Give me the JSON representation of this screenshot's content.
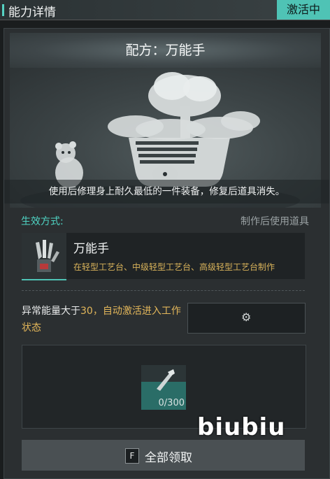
{
  "header": {
    "title": "能力详情",
    "status": "激活中"
  },
  "recipe": {
    "title": "配方：万能手",
    "description": "使用后修理身上耐久最低的一件装备，修复后道具消失。"
  },
  "effect": {
    "label": "生效方式:",
    "value": "制作后使用道具"
  },
  "item": {
    "name": "万能手",
    "craft_info": "在轻型工艺台、中级轻型工艺台、高级轻型工艺台制作"
  },
  "condition": {
    "prefix": "异常能量大于",
    "threshold": "30",
    "suffix": "，自动激活进入工作状态"
  },
  "settings_button": {
    "icon": "gear-icon"
  },
  "slot": {
    "count": "0/300",
    "progress_fraction": 0
  },
  "watermark": "biubiu",
  "claim": {
    "key": "F",
    "label": "全部领取"
  },
  "colors": {
    "accent": "#4fc3b5",
    "highlight": "#e2b65a",
    "effect_label": "#4fd4c4"
  }
}
